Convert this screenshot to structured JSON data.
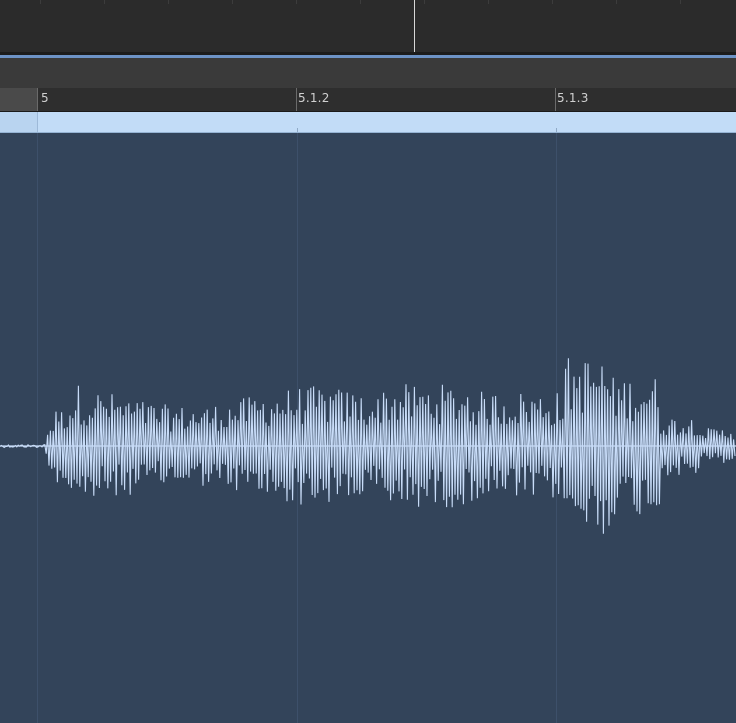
{
  "overview": {
    "playhead": "playhead"
  },
  "ruler": {
    "labels": [
      "5",
      "5.1.2",
      "5.1.3"
    ]
  },
  "region": {
    "color": "#c2dcf7",
    "waveform_color": "#c8dcf8",
    "background_color": "#33445a"
  }
}
